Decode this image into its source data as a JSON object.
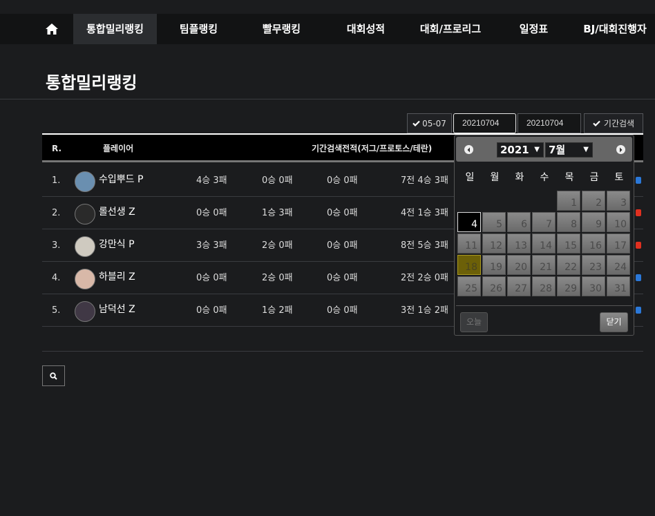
{
  "nav": {
    "items": [
      "통합밀리랭킹",
      "팀플랭킹",
      "빨무랭킹",
      "대회성적",
      "대회/프로리그",
      "일정표",
      "BJ/대회진행자"
    ],
    "active_index": 0
  },
  "page_title": "통합밀리랭킹",
  "filters": {
    "preset_label": "05-07",
    "start_date": "20210704",
    "end_date": "20210704",
    "search_label": "기간검색"
  },
  "table": {
    "headers": {
      "rank": "R.",
      "player": "플레이어",
      "record": "기간검색전적(저그/프로토스/테란)"
    },
    "rows": [
      {
        "rank": "1.",
        "name": "수입뿌드 P",
        "c1": "4승 3패",
        "c2": "0승 0패",
        "c3": "0승 0패",
        "total": "7전 4승 3패",
        "dot": "#2b78d8"
      },
      {
        "rank": "2.",
        "name": "롤선생 Z",
        "c1": "0승 0패",
        "c2": "1승 3패",
        "c3": "0승 0패",
        "total": "4전 1승 3패",
        "dot": "#e03020"
      },
      {
        "rank": "3.",
        "name": "강만식 P",
        "c1": "3승 3패",
        "c2": "2승 0패",
        "c3": "0승 0패",
        "total": "8전 5승 3패",
        "dot": "#e03020"
      },
      {
        "rank": "4.",
        "name": "하블리 Z",
        "c1": "0승 0패",
        "c2": "2승 0패",
        "c3": "0승 0패",
        "total": "2전 2승 0패",
        "dot": "#2b78d8"
      },
      {
        "rank": "5.",
        "name": "남덕선 Z",
        "c1": "0승 0패",
        "c2": "1승 2패",
        "c3": "0승 0패",
        "total": "3전 1승 2패",
        "dot": "#2b78d8"
      }
    ]
  },
  "calendar": {
    "year": "2021",
    "month": "7월",
    "weekdays": [
      "일",
      "월",
      "화",
      "수",
      "목",
      "금",
      "토"
    ],
    "first_weekday": 4,
    "days_in_month": 31,
    "today": 4,
    "selected": 18,
    "today_button": "오늘",
    "close_button": "닫기"
  },
  "colors": {
    "accent_selected": "#6c6008",
    "blue_dot": "#2b78d8",
    "red_dot": "#e03020"
  },
  "icons": {
    "home": "home-icon",
    "check": "check-icon",
    "search": "search-icon",
    "prev": "chevron-left-icon",
    "next": "chevron-right-icon"
  }
}
